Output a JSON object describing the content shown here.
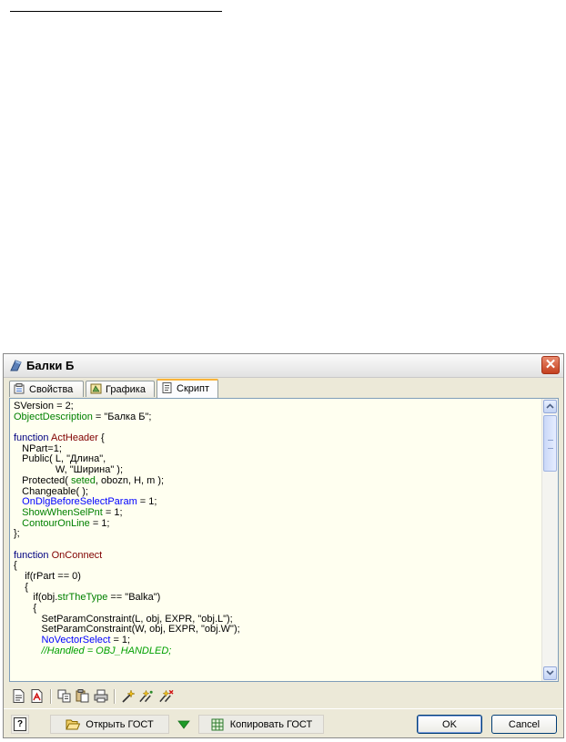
{
  "window": {
    "title": "Балки Б",
    "close_label": "✕"
  },
  "tabs": [
    {
      "label": "Свойства",
      "active": false
    },
    {
      "label": "Графика",
      "active": false
    },
    {
      "label": "Скрипт",
      "active": true
    }
  ],
  "editor": {
    "lines": [
      [
        {
          "t": "SVersion = 2;"
        }
      ],
      [
        {
          "t": "ObjectDescription",
          "c": "grn"
        },
        {
          "t": " = \"Балка Б\";"
        }
      ],
      [
        {
          "t": ""
        }
      ],
      [
        {
          "t": "function ",
          "c": "kw"
        },
        {
          "t": "ActHeader",
          "c": "fn"
        },
        {
          "t": " {"
        }
      ],
      [
        {
          "t": "   NPart=1;"
        }
      ],
      [
        {
          "t": "   Public( L, \"Длина\","
        }
      ],
      [
        {
          "t": "               W, \"Ширина\" );"
        }
      ],
      [
        {
          "t": "   Protected( "
        },
        {
          "t": "seted",
          "c": "grn"
        },
        {
          "t": ", obozn, H, m );"
        }
      ],
      [
        {
          "t": "   Changeable( );"
        }
      ],
      [
        {
          "t": "   OnDlgBeforeSelectParam",
          "c": "blue"
        },
        {
          "t": " = 1;"
        }
      ],
      [
        {
          "t": "   ShowWhenSelPnt",
          "c": "grn"
        },
        {
          "t": " = 1;"
        }
      ],
      [
        {
          "t": "   ContourOnLine",
          "c": "grn"
        },
        {
          "t": " = 1;"
        }
      ],
      [
        {
          "t": "};"
        }
      ],
      [
        {
          "t": ""
        }
      ],
      [
        {
          "t": "function ",
          "c": "kw"
        },
        {
          "t": "OnConnect",
          "c": "fn"
        }
      ],
      [
        {
          "t": "{"
        }
      ],
      [
        {
          "t": "    if(rPart == 0)"
        }
      ],
      [
        {
          "t": "    {"
        }
      ],
      [
        {
          "t": "       if(obj."
        },
        {
          "t": "strTheType",
          "c": "grn"
        },
        {
          "t": " == \"Balka\")"
        }
      ],
      [
        {
          "t": "       {"
        }
      ],
      [
        {
          "t": "          SetParamConstraint(L, obj, EXPR, \"obj.L\");"
        }
      ],
      [
        {
          "t": "          SetParamConstraint(W, obj, EXPR, \"obj.W\");"
        }
      ],
      [
        {
          "t": "          NoVectorSelect",
          "c": "blue"
        },
        {
          "t": " = 1;"
        }
      ],
      [
        {
          "t": "          //Handled = OBJ_HANDLED;",
          "c": "cmt"
        }
      ]
    ]
  },
  "toolbar": {
    "buttons": [
      "new-doc-icon",
      "pdf-icon",
      "copy-icon",
      "paste-icon",
      "print-icon",
      "wand-icon",
      "wand-multi-icon",
      "wand-remove-icon"
    ]
  },
  "bottom": {
    "help_label": "?",
    "open_gost_label": "Открыть ГОСТ",
    "copy_gost_label": "Копировать ГОСТ",
    "ok_label": "OK",
    "cancel_label": "Cancel"
  },
  "colors": {
    "keyword": "#000080",
    "function_name": "#800000",
    "property": "#008000",
    "blue_property": "#0000ff",
    "comment": "#00a000",
    "editor_bg": "#fffff0",
    "active_tab_accent": "#f8b33a"
  }
}
